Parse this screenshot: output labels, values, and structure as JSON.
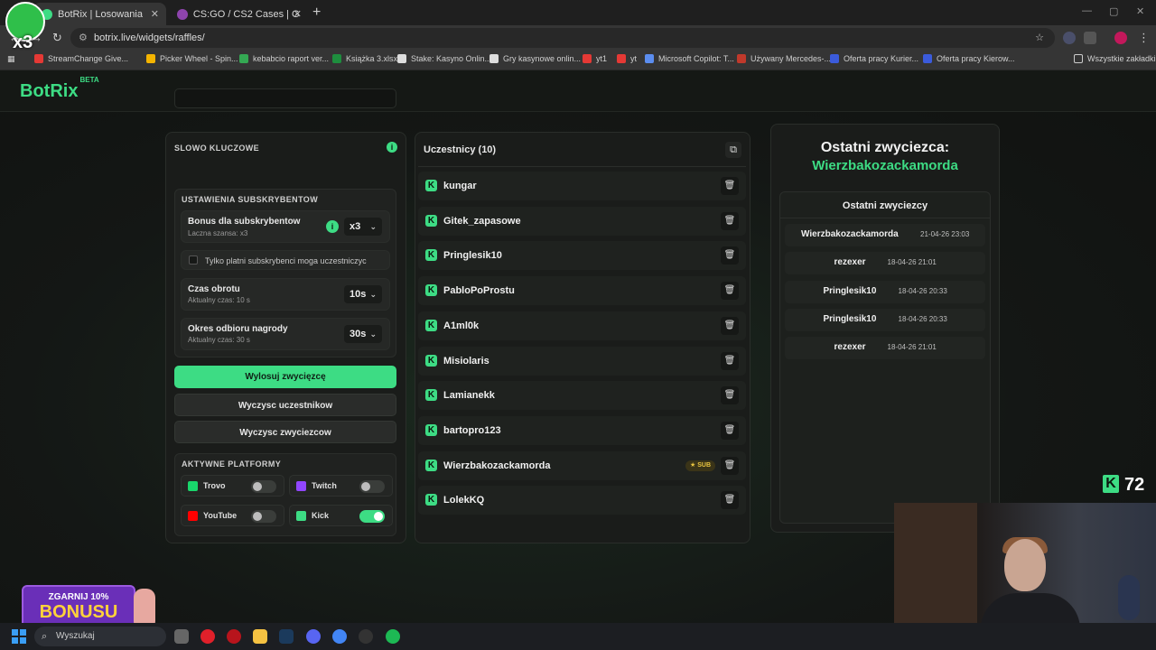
{
  "browser": {
    "tabs": [
      {
        "title": "BotRix | Losowania",
        "close": "✕"
      },
      {
        "title": "CS:GO / CS2 Cases | G4Skins Ca",
        "close": "✕"
      }
    ],
    "new_tab": "+",
    "url": "botrix.live/widgets/raffles/",
    "bookmarks": [
      {
        "label": "StreamChange Give...",
        "color": "#e53935"
      },
      {
        "label": "Picker Wheel - Spin...",
        "color": "#f4b400"
      },
      {
        "label": "kebabcio raport ver...",
        "color": "#34a853"
      },
      {
        "label": "Książka 3.xlsx",
        "color": "#1e8e3e"
      },
      {
        "label": "Stake: Kasyno Onlin...",
        "color": "#dddddd"
      },
      {
        "label": "Gry kasynowe onlin...",
        "color": "#dddddd"
      },
      {
        "label": "yt1",
        "color": "#e53935"
      },
      {
        "label": "yt",
        "color": "#e53935"
      },
      {
        "label": "Microsoft Copilot: T...",
        "color": "#5b8def"
      },
      {
        "label": "Używany Mercedes-...",
        "color": "#c0392b"
      },
      {
        "label": "Oferta pracy Kurier...",
        "color": "#3b5bdb"
      },
      {
        "label": "Oferta pracy Kierow...",
        "color": "#3b5bdb"
      }
    ],
    "all_bookmarks": "Wszystkie zakładki"
  },
  "app": {
    "logo": "BotRix",
    "logo_badge": "BETA"
  },
  "settings": {
    "keyword_title": "SLOWO KLUCZOWE",
    "info": "i",
    "keyword_value": "",
    "subs_title": "USTAWIENIA SUBSKRYBENTOW",
    "bonus_title": "Bonus dla subskrybentow",
    "bonus_sub": "Laczna szansa: x3",
    "bonus_value": "x3",
    "paid_only_label": "Tylko platni subskrybenci moga uczestniczyc",
    "spin_title": "Czas obrotu",
    "spin_sub": "Aktualny czas: 10 s",
    "spin_value": "10s",
    "claim_title": "Okres odbioru nagrody",
    "claim_sub": "Aktualny czas: 30 s",
    "claim_value": "30s",
    "draw_btn": "Wylosuj zwycięzcę",
    "clear_participants_btn": "Wyczysc uczestnikow",
    "clear_winners_btn": "Wyczysc zwyciezcow",
    "platforms_title": "AKTYWNE PLATFORMY",
    "platforms": [
      {
        "name": "Trovo",
        "color": "#19d66b",
        "enabled": false
      },
      {
        "name": "Twitch",
        "color": "#9146ff",
        "enabled": false
      },
      {
        "name": "YouTube",
        "color": "#ff0000",
        "enabled": false
      },
      {
        "name": "Kick",
        "color": "#3ddc84",
        "enabled": true
      }
    ]
  },
  "participants": {
    "title": "Uczestnicy (10)",
    "sub_badge": "★ SUB",
    "list": [
      {
        "name": "kungar",
        "sub": false
      },
      {
        "name": "Gitek_zapasowe",
        "sub": false
      },
      {
        "name": "Pringlesik10",
        "sub": false
      },
      {
        "name": "PabloPoProstu",
        "sub": false
      },
      {
        "name": "A1ml0k",
        "sub": false
      },
      {
        "name": "Misiolaris",
        "sub": false
      },
      {
        "name": "Lamianekk",
        "sub": false
      },
      {
        "name": "bartopro123",
        "sub": false
      },
      {
        "name": "Wierzbakozackamorda",
        "sub": true
      },
      {
        "name": "LolekKQ",
        "sub": false
      }
    ]
  },
  "winners": {
    "last_winner_label": "Ostatni zwyciezca:",
    "last_winner_name": "Wierzbakozackamorda",
    "recent_title": "Ostatni zwyciezcy",
    "list": [
      {
        "name": "Wierzbakozackamorda",
        "date": "21-04-26 23:03"
      },
      {
        "name": "rezexer",
        "date": "18-04-26 21:01"
      },
      {
        "name": "Pringlesik10",
        "date": "18-04-26 20:33"
      },
      {
        "name": "Pringlesik10",
        "date": "18-04-26 20:33"
      },
      {
        "name": "rezexer",
        "date": "18-04-26 21:01"
      }
    ]
  },
  "overlay": {
    "kick_count": "72",
    "avatar_text": "x3",
    "promo_line1": "ZGARNIJ 10%",
    "promo_line2": "BONUSU"
  },
  "taskbar": {
    "search_placeholder": "Wyszukaj"
  }
}
